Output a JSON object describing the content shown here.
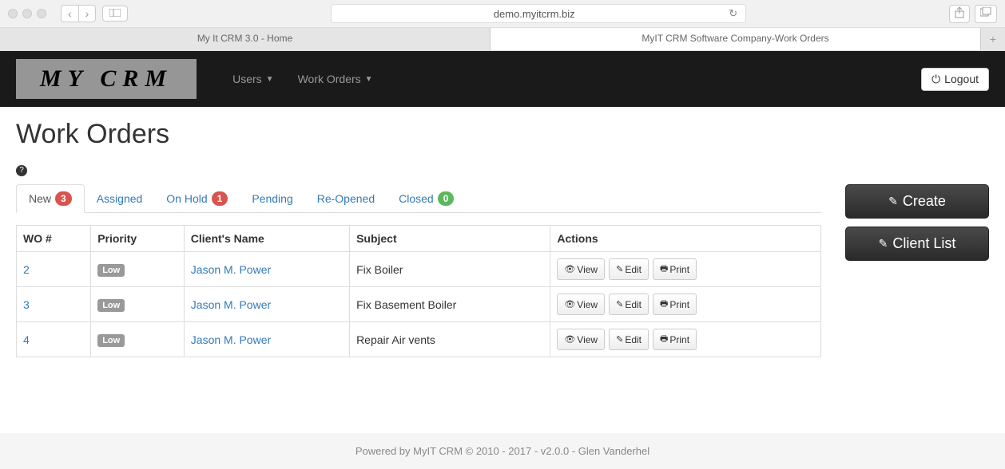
{
  "browser": {
    "url": "demo.myitcrm.biz",
    "tabs": [
      {
        "label": "My It CRM 3.0 - Home"
      },
      {
        "label": "MyIT CRM Software Company-Work Orders"
      }
    ]
  },
  "navbar": {
    "logo": "MY CRM",
    "items": [
      "Users",
      "Work Orders"
    ],
    "logout": "Logout"
  },
  "page_title": "Work Orders",
  "tabs": [
    {
      "label": "New",
      "badge": "3",
      "badge_class": "badge-red",
      "active": true
    },
    {
      "label": "Assigned",
      "badge": null
    },
    {
      "label": "On Hold",
      "badge": "1",
      "badge_class": "badge-red"
    },
    {
      "label": "Pending",
      "badge": null
    },
    {
      "label": "Re-Opened",
      "badge": null
    },
    {
      "label": "Closed",
      "badge": "0",
      "badge_class": "badge-green"
    }
  ],
  "table": {
    "headers": [
      "WO #",
      "Priority",
      "Client's Name",
      "Subject",
      "Actions"
    ],
    "rows": [
      {
        "wo": "2",
        "priority": "Low",
        "client": "Jason M. Power",
        "subject": "Fix Boiler"
      },
      {
        "wo": "3",
        "priority": "Low",
        "client": "Jason M. Power",
        "subject": "Fix Basement Boiler"
      },
      {
        "wo": "4",
        "priority": "Low",
        "client": "Jason M. Power",
        "subject": "Repair Air vents"
      }
    ],
    "action_labels": {
      "view": "View",
      "edit": "Edit",
      "print": "Print"
    }
  },
  "side_buttons": {
    "create": "Create",
    "client_list": "Client List"
  },
  "footer": "Powered by MyIT CRM © 2010 - 2017 - v2.0.0 - Glen Vanderhel"
}
